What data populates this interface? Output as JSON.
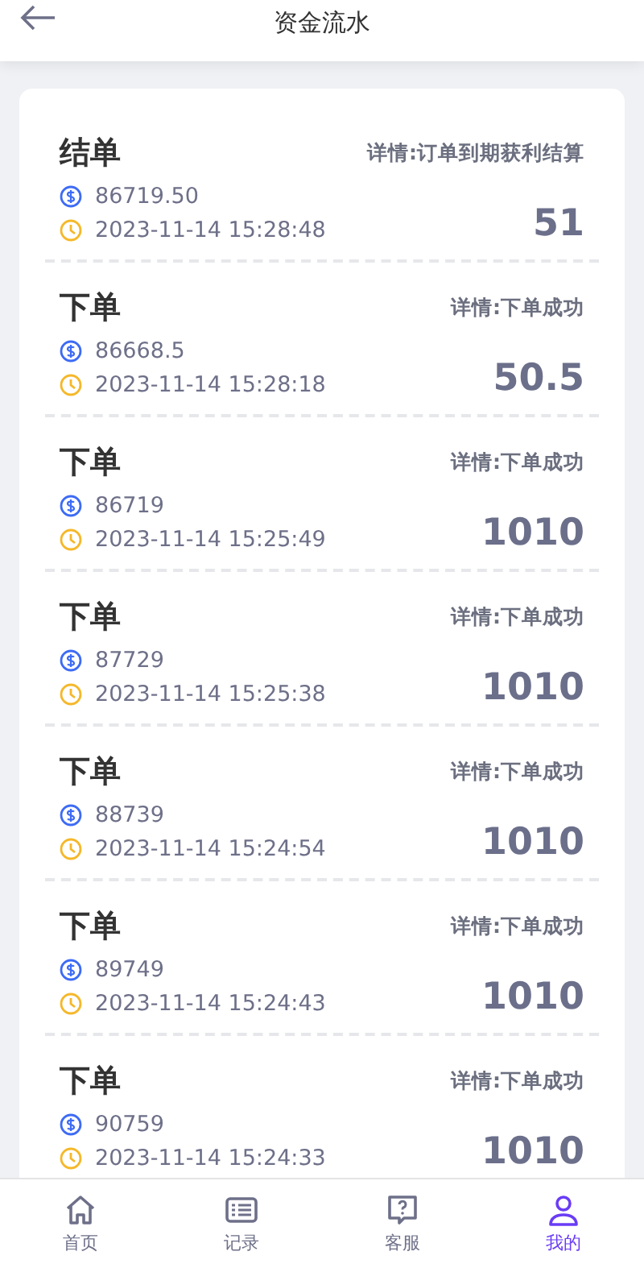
{
  "header": {
    "title": "资金流水"
  },
  "records": [
    {
      "type": "结单",
      "detail": "详情:订单到期获利结算",
      "balance": "86719.50",
      "time": "2023-11-14 15:28:48",
      "amount": "51"
    },
    {
      "type": "下单",
      "detail": "详情:下单成功",
      "balance": "86668.5",
      "time": "2023-11-14 15:28:18",
      "amount": "50.5"
    },
    {
      "type": "下单",
      "detail": "详情:下单成功",
      "balance": "86719",
      "time": "2023-11-14 15:25:49",
      "amount": "1010"
    },
    {
      "type": "下单",
      "detail": "详情:下单成功",
      "balance": "87729",
      "time": "2023-11-14 15:25:38",
      "amount": "1010"
    },
    {
      "type": "下单",
      "detail": "详情:下单成功",
      "balance": "88739",
      "time": "2023-11-14 15:24:54",
      "amount": "1010"
    },
    {
      "type": "下单",
      "detail": "详情:下单成功",
      "balance": "89749",
      "time": "2023-11-14 15:24:43",
      "amount": "1010"
    },
    {
      "type": "下单",
      "detail": "详情:下单成功",
      "balance": "90759",
      "time": "2023-11-14 15:24:33",
      "amount": "1010"
    }
  ],
  "tabbar": [
    {
      "kind": "home",
      "label": "首页",
      "selected": false
    },
    {
      "kind": "records",
      "label": "记录",
      "selected": false
    },
    {
      "kind": "service",
      "label": "客服",
      "selected": false
    },
    {
      "kind": "profile",
      "label": "我的",
      "selected": true
    }
  ]
}
